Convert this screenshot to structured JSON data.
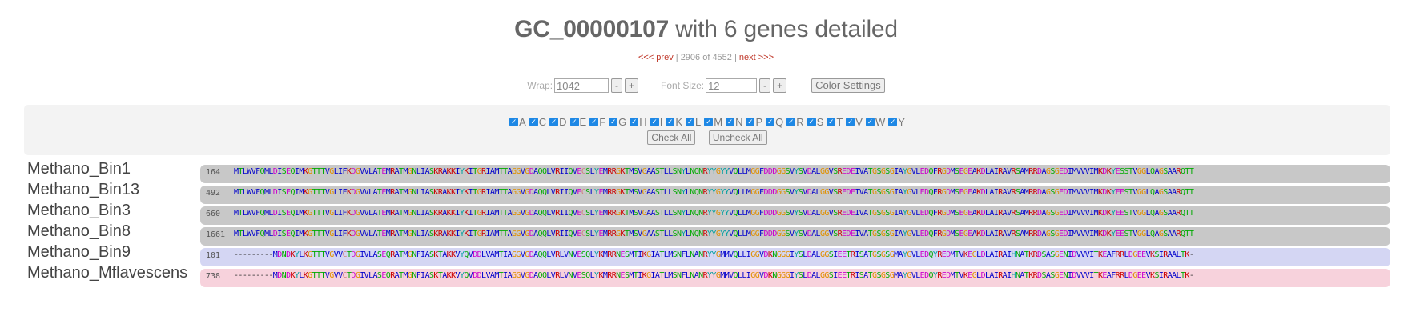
{
  "header": {
    "title_bold": "GC_00000107",
    "title_rest": " with 6 genes detailed"
  },
  "pager": {
    "prev_label": "<<< prev",
    "position": "2906 of 4552",
    "next_label": "next >>>"
  },
  "controls": {
    "wrap_label": "Wrap:",
    "wrap_value": "1042",
    "minus": "-",
    "plus": "+",
    "fontsize_label": "Font Size:",
    "fontsize_value": "12",
    "color_settings_label": "Color Settings"
  },
  "filters": {
    "amino_acids": [
      "A",
      "C",
      "D",
      "E",
      "F",
      "G",
      "H",
      "I",
      "K",
      "L",
      "M",
      "N",
      "P",
      "Q",
      "R",
      "S",
      "T",
      "V",
      "W",
      "Y"
    ],
    "check_all_label": "Check All",
    "uncheck_all_label": "Uncheck All"
  },
  "colors": {
    "gray_bar": "#c8c8c8",
    "blue_bar": "#d4d6f3",
    "pink_bar": "#f7d2dc"
  },
  "genes": [
    {
      "name": "Methano_Bin1",
      "start": "164",
      "sequence": "MTLWVFQMLDISEQIMKGTTTVGLIFKDGVVLATEMRATMGNLIASKRAKKIYKITGRIAMTTAGGVGDAQQLVRIIQVECSLYEMRRGKTMSVGAASTLLSNYLNQNRYYGYYVQLLMGGFDDDGGSVYSVDALGGVSREDEIVATGSGSGIAYGVLEDQFRGDMSEGEAKDLAIRAVRSAMRRDAGSGEDIMVVVIMKDKYESSTVGGLQAGSAARQTT",
      "bar": "gray"
    },
    {
      "name": "Methano_Bin13",
      "start": "492",
      "sequence": "MTLWVFQMLDISEQIMKGTTTVGLIFKDGVVLATEMRATMGNLIASKRAKKIYKITGRIAMTTAGGVGDAQQLVRIIQVECSLYEMRRGKTMSVGAASTLLSNYLNQNRYYGYYVQLLMGGFDDDGGSVYSVDALGGVSREDEIVATGSGSGIAYGVLEDQFRGDMSEGEAKDLAIRAVRSAMRRDAGSGEDIMVVVIMKDKYEESTVGGLQAGSAARQTT",
      "bar": "gray"
    },
    {
      "name": "Methano_Bin3",
      "start": "660",
      "sequence": "MTLWVFQMLDISEQIMKGTTTVGLIFKDGVVLATEMRATMGNLIASKRAKKIYKITGRIAMTTAGGVGDAQQLVRIIQVECSLYEMRRGKTMSVGAASTLLSNYLNQNRYYGYYVQLLMGGFDDDGGSVYSVDALGGVSREDEIVATGSGSGIAYGVLEDQFRGDMSEGEAKDLAIRAVRSAMRRDAGSGEDIMVVVIMKDKYEESTVGGLQAGSAARQTT",
      "bar": "gray"
    },
    {
      "name": "Methano_Bin8",
      "start": "1661",
      "sequence": "MTLWVFQMLDISEQIMKGTTTVGLIFKDGVVLATEMRATMGNLIASKRAKKIYKITGRIAMTTAGGVGDAQQLVRIIQVECSLYEMRRGKTMSVGAASTLLSNYLNQNRYYGYYVQLLMGGFDDDGGSVYSVDALGGVSREDEIVATGSGSGIAYGVLEDQFRGDMSEGEAKDLAIRAVRSAMRRDAGSGEDIMVVVIMKDKYEESTVGGLQAGSAARQTT",
      "bar": "gray"
    },
    {
      "name": "Methano_Bin9",
      "start": "101",
      "sequence": "---------MDNDKYLKGTTTVGVVCTDGIVLASEQRATMGNFIASKTAKKVYQVDDLVAMTIAGGVGDAQQLVRLVNVESQLYKMRRNESMTIKGIATLMSNFLNANRYYGMMVQLLIGGVDKNGGGIYSLDALGGSIEETRISATGSGSGMAYGVLEDQYREDMTVKEGLDLAIRAIHNATKRDSASGENIDVVVITKEAFRRLDGEEVKSIRAALTK-",
      "bar": "blue"
    },
    {
      "name": "Methano_Mflavescens",
      "start": "738",
      "sequence": "---------MDNDKYLKGTTTVGVVCTDGIVLASEQRATMGNFIASKTAKKVYQVDDLVAMTIAGGVGDAQQLVRLVNVESQLYKMRRNESMTIKGIATLMSNFLNANRYYGMMVQLLIGGVDKNGGGIYSLDALGGSIEETRISATGSGSGMAYGVLEDQYREDMTVKEGLDLAIRAIHNATKRDSASGENIDVVVITKEAFRRLDGEEVKSIRAALTK-",
      "bar": "pink"
    }
  ]
}
